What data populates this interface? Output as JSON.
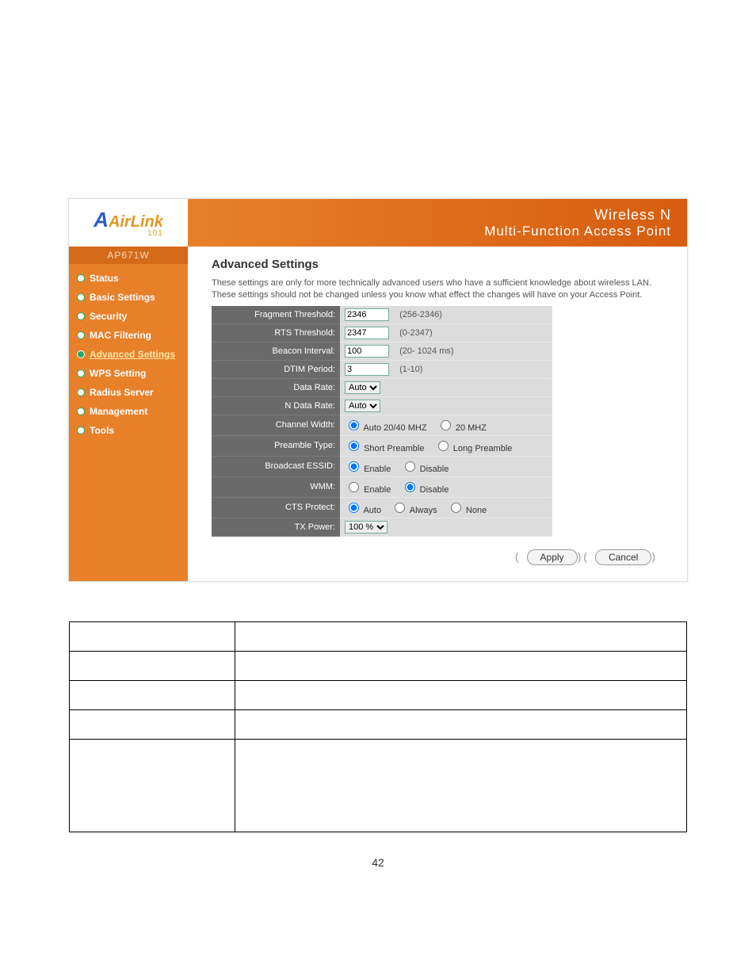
{
  "page_number": "42",
  "logo": {
    "text": "AirLink",
    "sub": "101"
  },
  "banner": {
    "line1": "Wireless N",
    "line2": "Multi-Function Access Point"
  },
  "model": "AP671W",
  "nav": [
    {
      "label": "Status",
      "selected": false
    },
    {
      "label": "Basic Settings",
      "selected": false
    },
    {
      "label": "Security",
      "selected": false
    },
    {
      "label": "MAC Filtering",
      "selected": false
    },
    {
      "label": "Advanced Settings",
      "selected": true
    },
    {
      "label": "WPS Setting",
      "selected": false
    },
    {
      "label": "Radius Server",
      "selected": false
    },
    {
      "label": "Management",
      "selected": false
    },
    {
      "label": "Tools",
      "selected": false
    }
  ],
  "content": {
    "title": "Advanced Settings",
    "desc": "These settings are only for more technically advanced users who have a sufficient knowledge about wireless LAN. These settings should not be changed unless you know what effect the changes will have on your Access Point."
  },
  "settings": {
    "fragment_threshold": {
      "label": "Fragment Threshold:",
      "value": "2346",
      "hint": "(256-2346)"
    },
    "rts_threshold": {
      "label": "RTS Threshold:",
      "value": "2347",
      "hint": "(0-2347)"
    },
    "beacon_interval": {
      "label": "Beacon Interval:",
      "value": "100",
      "hint": "(20- 1024 ms)"
    },
    "dtim_period": {
      "label": "DTIM Period:",
      "value": "3",
      "hint": "(1-10)"
    },
    "data_rate": {
      "label": "Data Rate:",
      "value": "Auto"
    },
    "n_data_rate": {
      "label": "N Data Rate:",
      "value": "Auto"
    },
    "channel_width": {
      "label": "Channel Width:",
      "opt1": "Auto 20/40 MHZ",
      "opt2": "20 MHZ",
      "selected": "opt1"
    },
    "preamble_type": {
      "label": "Preamble Type:",
      "opt1": "Short Preamble",
      "opt2": "Long Preamble",
      "selected": "opt1"
    },
    "broadcast_essid": {
      "label": "Broadcast ESSID:",
      "opt1": "Enable",
      "opt2": "Disable",
      "selected": "opt1"
    },
    "wmm": {
      "label": "WMM:",
      "opt1": "Enable",
      "opt2": "Disable",
      "selected": "opt2"
    },
    "cts_protect": {
      "label": "CTS Protect:",
      "opt1": "Auto",
      "opt2": "Always",
      "opt3": "None",
      "selected": "opt1"
    },
    "tx_power": {
      "label": "TX Power:",
      "value": "100 %"
    }
  },
  "buttons": {
    "apply": "Apply",
    "cancel": "Cancel"
  },
  "def_table": [
    {
      "term": "",
      "desc": ""
    },
    {
      "term": "",
      "desc": ""
    },
    {
      "term": "",
      "desc": ""
    },
    {
      "term": "",
      "desc": ""
    },
    {
      "term": "",
      "desc": ""
    }
  ]
}
